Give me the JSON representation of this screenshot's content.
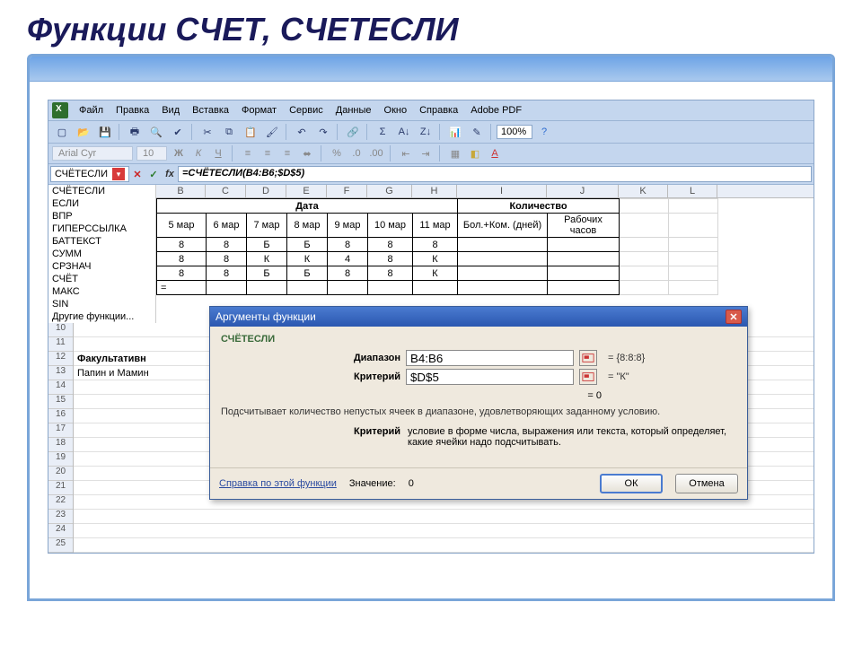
{
  "slide": {
    "title": "Функции СЧЕТ, СЧЕТЕСЛИ"
  },
  "menu": {
    "file": "Файл",
    "edit": "Правка",
    "view": "Вид",
    "insert": "Вставка",
    "format": "Формат",
    "tools": "Сервис",
    "data": "Данные",
    "window": "Окно",
    "help": "Справка",
    "adobe": "Adobe PDF"
  },
  "toolbar": {
    "zoom": "100%"
  },
  "fontbar": {
    "font": "Arial Cyr",
    "size": "10"
  },
  "formulabar": {
    "namebox": "СЧЁТЕСЛИ",
    "formula": "=СЧЁТЕСЛИ(B4:B6;$D$5)"
  },
  "fnlist": [
    "СЧЁТЕСЛИ",
    "ЕСЛИ",
    "ВПР",
    "ГИПЕРССЫЛКА",
    "БАТТЕКСТ",
    "СУММ",
    "СРЗНАЧ",
    "СЧЁТ",
    "МАКС",
    "SIN",
    "Другие функции..."
  ],
  "cols": [
    "B",
    "C",
    "D",
    "E",
    "F",
    "G",
    "H",
    "I",
    "J",
    "K",
    "L"
  ],
  "header1": {
    "date": "Дата",
    "qty": "Количество"
  },
  "header2": [
    "5 мар",
    "6 мар",
    "7 мар",
    "8 мар",
    "9 мар",
    "10 мар",
    "11 мар",
    "Бол.+Ком. (дней)",
    "Рабочих часов"
  ],
  "rows": [
    [
      "8",
      "8",
      "Б",
      "Б",
      "8",
      "8",
      "8",
      "",
      ""
    ],
    [
      "8",
      "8",
      "К",
      "К",
      "4",
      "8",
      "К",
      "",
      ""
    ],
    [
      "8",
      "8",
      "Б",
      "Б",
      "8",
      "8",
      "К",
      "",
      ""
    ],
    [
      "=",
      "",
      "",
      "",
      "",
      "",
      "",
      "",
      ""
    ]
  ],
  "lower": {
    "rownums": [
      "10",
      "11",
      "12",
      "13",
      "14",
      "15",
      "16",
      "17",
      "18",
      "19",
      "20",
      "21",
      "22",
      "23",
      "24",
      "25"
    ],
    "r12": "Факультативн",
    "r13": "Папин и Мамин"
  },
  "dialog": {
    "title": "Аргументы функции",
    "fn": "СЧЁТЕСЛИ",
    "arg1_label": "Диапазон",
    "arg1_value": "B4:B6",
    "arg1_result": "= {8:8:8}",
    "arg2_label": "Критерий",
    "arg2_value": "$D$5",
    "arg2_result": "= \"К\"",
    "preview": "= 0",
    "description": "Подсчитывает количество непустых ячеек в диапазоне, удовлетворяющих заданному условию.",
    "argdesc_label": "Критерий",
    "argdesc_text": "условие в форме числа, выражения или текста, который определяет, какие ячейки надо подсчитывать.",
    "help": "Справка по этой функции",
    "value_label": "Значение:",
    "value": "0",
    "ok": "ОК",
    "cancel": "Отмена"
  }
}
